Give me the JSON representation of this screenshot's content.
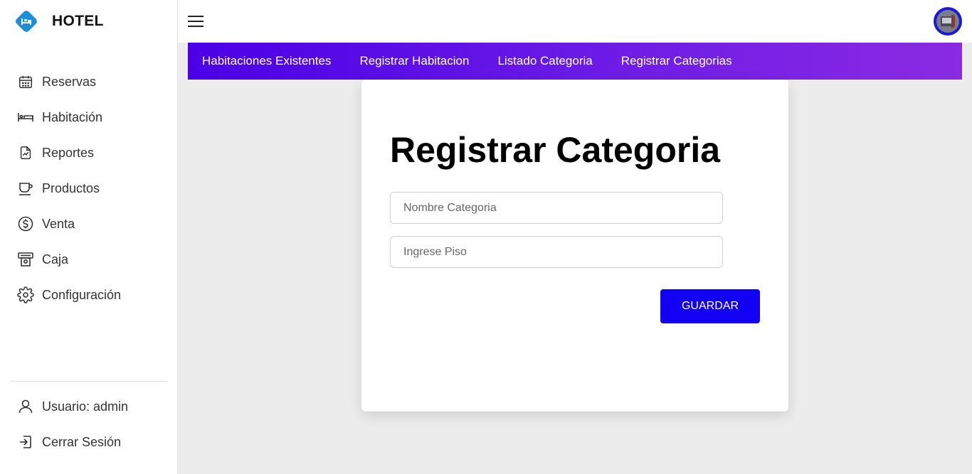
{
  "app": {
    "title": "HOTEL",
    "logo_icon": "hotel-bed-icon",
    "accent": "#1a8fd6"
  },
  "sidebar": {
    "items": [
      {
        "label": "Reservas",
        "icon": "calendar-icon"
      },
      {
        "label": "Habitación",
        "icon": "bed-icon"
      },
      {
        "label": "Reportes",
        "icon": "report-icon"
      },
      {
        "label": "Productos",
        "icon": "cup-icon"
      },
      {
        "label": "Venta",
        "icon": "dollar-icon"
      },
      {
        "label": "Caja",
        "icon": "cash-register-icon"
      },
      {
        "label": "Configuración",
        "icon": "gear-icon"
      }
    ],
    "bottom": [
      {
        "label": "Usuario: admin",
        "icon": "user-icon"
      },
      {
        "label": "Cerrar Sesión",
        "icon": "logout-icon"
      }
    ]
  },
  "topbar": {
    "menu_icon": "hamburger-icon",
    "avatar_icon": "avatar"
  },
  "tabs": [
    {
      "label": "Habitaciones Existentes"
    },
    {
      "label": "Registrar Habitacion"
    },
    {
      "label": "Listado Categoria"
    },
    {
      "label": "Registrar Categorias"
    }
  ],
  "tabbar_colors": {
    "start": "#4b00e6",
    "end": "#8a2be2"
  },
  "form": {
    "title": "Registrar Categoria",
    "fields": [
      {
        "placeholder": "Nombre Categoria",
        "value": ""
      },
      {
        "placeholder": "Ingrese Piso",
        "value": ""
      }
    ],
    "save_label": "GUARDAR",
    "save_color": "#1200f5"
  }
}
